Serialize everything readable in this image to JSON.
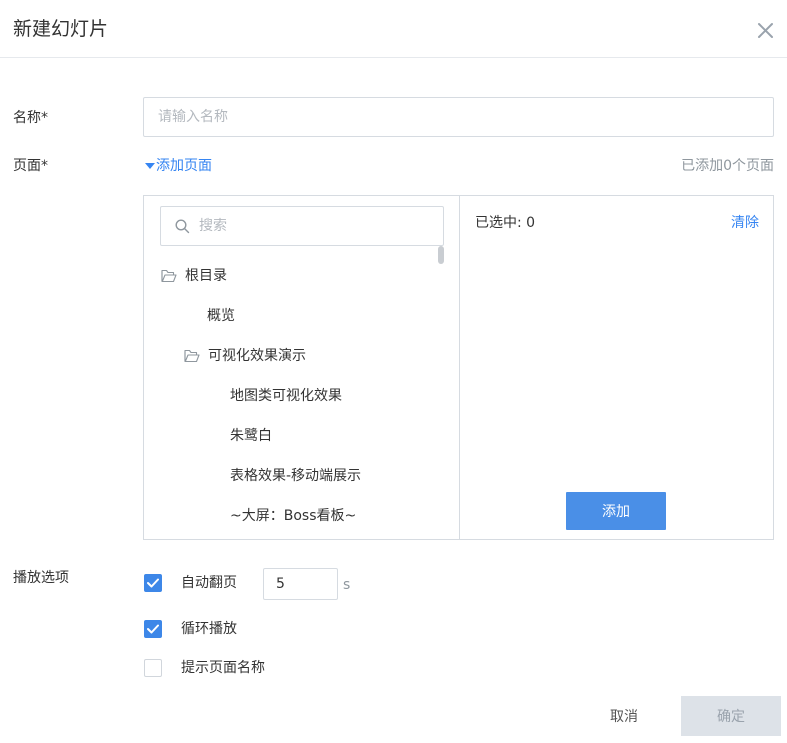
{
  "dialog": {
    "title": "新建幻灯片",
    "close_icon": "close-icon"
  },
  "form": {
    "name_label": "名称*",
    "name_placeholder": "请输入名称",
    "name_value": "",
    "page_label": "页面*",
    "add_page_toggle": "添加页面",
    "added_count_text": "已添加0个页面",
    "play_options_label": "播放选项"
  },
  "picker": {
    "search_placeholder": "搜索",
    "tree": [
      {
        "label": "根目录",
        "type": "folder",
        "depth": 0
      },
      {
        "label": "概览",
        "type": "page",
        "depth": 1
      },
      {
        "label": "可视化效果演示",
        "type": "folder",
        "depth": 1
      },
      {
        "label": "地图类可视化效果",
        "type": "page",
        "depth": 2
      },
      {
        "label": "朱鹭白",
        "type": "page",
        "depth": 2
      },
      {
        "label": "表格效果-移动端展示",
        "type": "page",
        "depth": 2
      },
      {
        "label": "~大屏：Boss看板~",
        "type": "page",
        "depth": 2
      }
    ],
    "selected_count_text": "已选中: 0",
    "clear_label": "清除",
    "add_button_label": "添加"
  },
  "options": {
    "auto_flip": {
      "label": "自动翻页",
      "checked": true,
      "interval": "5",
      "unit": "s"
    },
    "loop_play": {
      "label": "循环播放",
      "checked": true
    },
    "show_page_name": {
      "label": "提示页面名称",
      "checked": false
    }
  },
  "footer": {
    "cancel_label": "取消",
    "confirm_label": "确定"
  },
  "colors": {
    "accent": "#3685f2",
    "add_button_bg": "#4a8fe7",
    "checkbox_checked": "#3d87e8",
    "confirm_disabled_bg": "#dde2e8",
    "border": "#d6dbe1"
  }
}
